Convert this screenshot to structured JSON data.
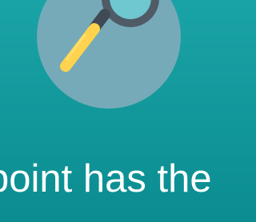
{
  "illustration": {
    "circle_color": "#76aab8",
    "lens_frame_color": "#4f5b66",
    "lens_glass_color": "#6fc7d0",
    "handle_color": "#ffd34d",
    "icon": "magnifying-glass-icon"
  },
  "caption": {
    "line1": "point has the",
    "line2": ""
  }
}
